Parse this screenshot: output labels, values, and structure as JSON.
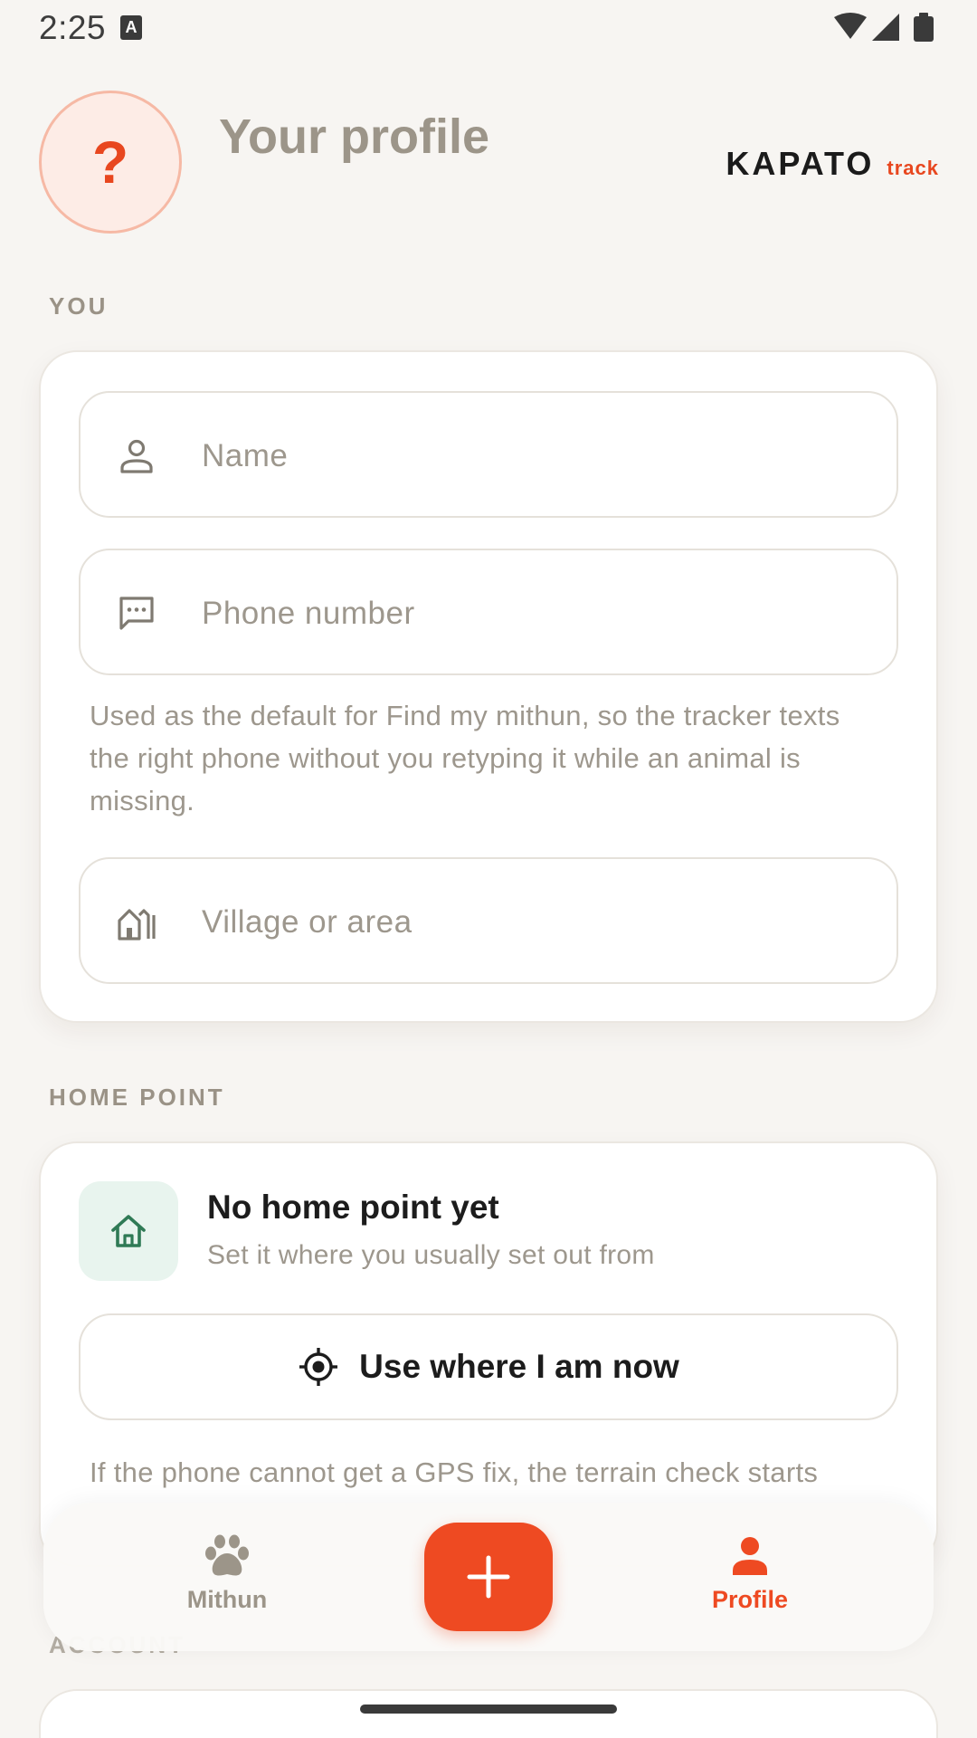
{
  "status_bar": {
    "time": "2:25",
    "notification_glyph": "A",
    "icons": [
      "wifi-icon",
      "signal-icon",
      "battery-icon"
    ]
  },
  "header": {
    "title": "Your profile",
    "avatar_glyph": "?",
    "brand_name": "KAPATO",
    "brand_sub": "track"
  },
  "you_section": {
    "label": "YOU",
    "name_field": {
      "placeholder": "Name",
      "value": "",
      "icon": "person-icon"
    },
    "phone_field": {
      "placeholder": "Phone number",
      "value": "",
      "icon": "message-icon"
    },
    "phone_helper": "Used as the default for Find my mithun, so the tracker texts the right phone without you retyping it while an animal is missing.",
    "village_field": {
      "placeholder": "Village or area",
      "value": "",
      "icon": "village-icon"
    }
  },
  "home_section": {
    "label": "HOME POINT",
    "title": "No home point yet",
    "subtitle": "Set it where you usually set out from",
    "button_label": "Use where I am now",
    "gps_note": "If the phone cannot get a GPS fix, the terrain check starts"
  },
  "bottom_nav": {
    "items": [
      {
        "label": "Mithun",
        "icon": "paw-icon",
        "active": false
      },
      {
        "label": "Profile",
        "icon": "person-icon",
        "active": true
      }
    ],
    "fab_icon": "plus-icon"
  },
  "account_section": {
    "label": "ACCOUNT"
  },
  "colors": {
    "accent": "#ee4a22",
    "background": "#f7f5f2",
    "muted_text": "#9d978d",
    "home_tile": "#e8f4ee",
    "home_icon": "#2f7a55"
  }
}
